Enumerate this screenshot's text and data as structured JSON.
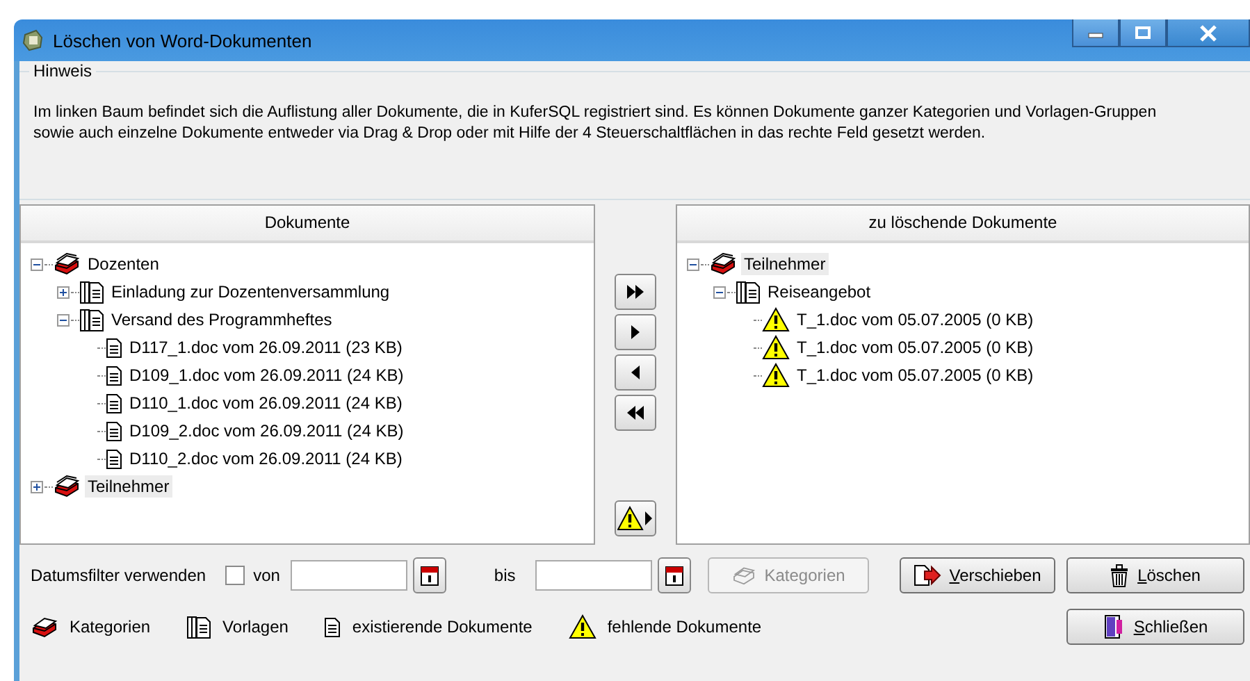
{
  "window": {
    "title": "Löschen von Word-Dokumenten"
  },
  "hint": {
    "title": "Hinweis",
    "text": "Im linken Baum befindet sich die Auflistung aller Dokumente, die in KuferSQL registriert sind. Es können Dokumente ganzer Kategorien und Vorlagen-Gruppen sowie auch einzelne Dokumente entweder via Drag & Drop oder mit Hilfe der 4 Steuerschaltflächen in das rechte Feld gesetzt werden."
  },
  "left_tree": {
    "header": "Dokumente",
    "nodes": [
      {
        "kind": "category",
        "label": "Dozenten",
        "expanded": true,
        "selected": false,
        "children": [
          {
            "kind": "template",
            "label": "Einladung zur Dozentenversammlung",
            "expanded": false,
            "selected": false
          },
          {
            "kind": "template",
            "label": "Versand des Programmheftes",
            "expanded": true,
            "selected": false,
            "children": [
              {
                "kind": "document",
                "label": "D117_1.doc vom 26.09.2011 (23 KB)",
                "selected": false
              },
              {
                "kind": "document",
                "label": "D109_1.doc vom 26.09.2011 (24 KB)",
                "selected": false
              },
              {
                "kind": "document",
                "label": "D110_1.doc vom 26.09.2011 (24 KB)",
                "selected": false
              },
              {
                "kind": "document",
                "label": "D109_2.doc vom 26.09.2011 (24 KB)",
                "selected": false
              },
              {
                "kind": "document",
                "label": "D110_2.doc vom 26.09.2011 (24 KB)",
                "selected": false
              }
            ]
          }
        ]
      },
      {
        "kind": "category",
        "label": "Teilnehmer",
        "expanded": false,
        "selected": true
      }
    ]
  },
  "move_buttons": [
    {
      "kind": "all_right"
    },
    {
      "kind": "right"
    },
    {
      "kind": "left"
    },
    {
      "kind": "all_left"
    }
  ],
  "missing_button": {
    "kind": "missing_right"
  },
  "right_tree": {
    "header": "zu löschende Dokumente",
    "nodes": [
      {
        "kind": "category",
        "label": "Teilnehmer",
        "expanded": true,
        "selected": true,
        "children": [
          {
            "kind": "template",
            "label": "Reiseangebot",
            "expanded": true,
            "selected": false,
            "children": [
              {
                "kind": "missing",
                "label": "T_1.doc vom 05.07.2005 (0 KB)",
                "selected": false
              },
              {
                "kind": "missing",
                "label": "T_1.doc vom 05.07.2005 (0 KB)",
                "selected": false
              },
              {
                "kind": "missing",
                "label": "T_1.doc vom 05.07.2005 (0 KB)",
                "selected": false
              }
            ]
          }
        ]
      }
    ]
  },
  "filter": {
    "label": "Datumsfilter verwenden",
    "checkbox_label": "von",
    "checked": false,
    "to_label": "bis"
  },
  "buttons": [
    {
      "kind": "categories",
      "label": "Kategorien",
      "disabled": true
    },
    {
      "kind": "move",
      "label": "Verschieben",
      "disabled": false
    },
    {
      "kind": "delete",
      "label": "Löschen",
      "disabled": false
    }
  ],
  "legend": [
    {
      "kind": "category",
      "label": "Kategorien"
    },
    {
      "kind": "template",
      "label": "Vorlagen"
    },
    {
      "kind": "document",
      "label": "existierende Dokumente"
    },
    {
      "kind": "missing",
      "label": "fehlende Dokumente"
    }
  ],
  "close_button": {
    "kind": "close",
    "label": "Schließen"
  }
}
